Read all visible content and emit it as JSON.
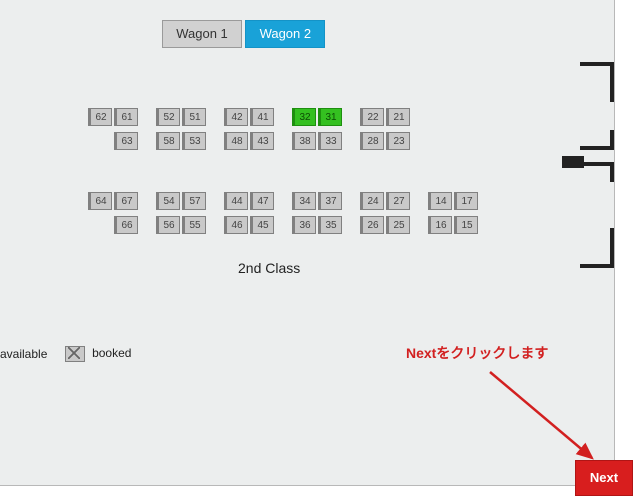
{
  "tabs": {
    "wagon1": "Wagon 1",
    "wagon2": "Wagon 2"
  },
  "class_label": "2nd Class",
  "legend": {
    "available": "available",
    "booked": "booked"
  },
  "instruction": "Nextをクリックします",
  "next_label": "Next",
  "seat_map": {
    "groups": [
      {
        "rows": [
          [
            "62",
            "61"
          ],
          [
            "",
            "63"
          ],
          "AISLE",
          [
            "64",
            "67"
          ],
          [
            "",
            "66"
          ]
        ]
      },
      {
        "rows": [
          [
            "52",
            "51"
          ],
          [
            "58",
            "53"
          ],
          "AISLE",
          [
            "54",
            "57"
          ],
          [
            "56",
            "55"
          ]
        ]
      },
      {
        "rows": [
          [
            "42",
            "41"
          ],
          [
            "48",
            "43"
          ],
          "AISLE",
          [
            "44",
            "47"
          ],
          [
            "46",
            "45"
          ]
        ]
      },
      {
        "rows": [
          [
            "32",
            "31"
          ],
          [
            "38",
            "33"
          ],
          "AISLE",
          [
            "34",
            "37"
          ],
          [
            "36",
            "35"
          ]
        ]
      },
      {
        "rows": [
          [
            "22",
            "21"
          ],
          [
            "28",
            "23"
          ],
          "AISLE",
          [
            "24",
            "27"
          ],
          [
            "26",
            "25"
          ]
        ]
      },
      {
        "rows": [
          [
            "",
            ""
          ],
          [
            "",
            ""
          ],
          "AISLE",
          [
            "14",
            "17"
          ],
          [
            "16",
            "15"
          ]
        ]
      }
    ],
    "selected": [
      "32",
      "31"
    ]
  }
}
